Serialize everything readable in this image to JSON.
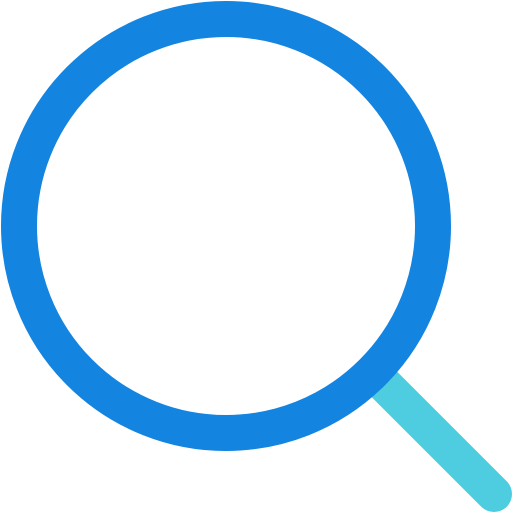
{
  "icon": {
    "name": "search-icon",
    "colors": {
      "lens": "#1384E0",
      "handle": "#4DCDDF",
      "background": "#FFFFFF"
    }
  }
}
